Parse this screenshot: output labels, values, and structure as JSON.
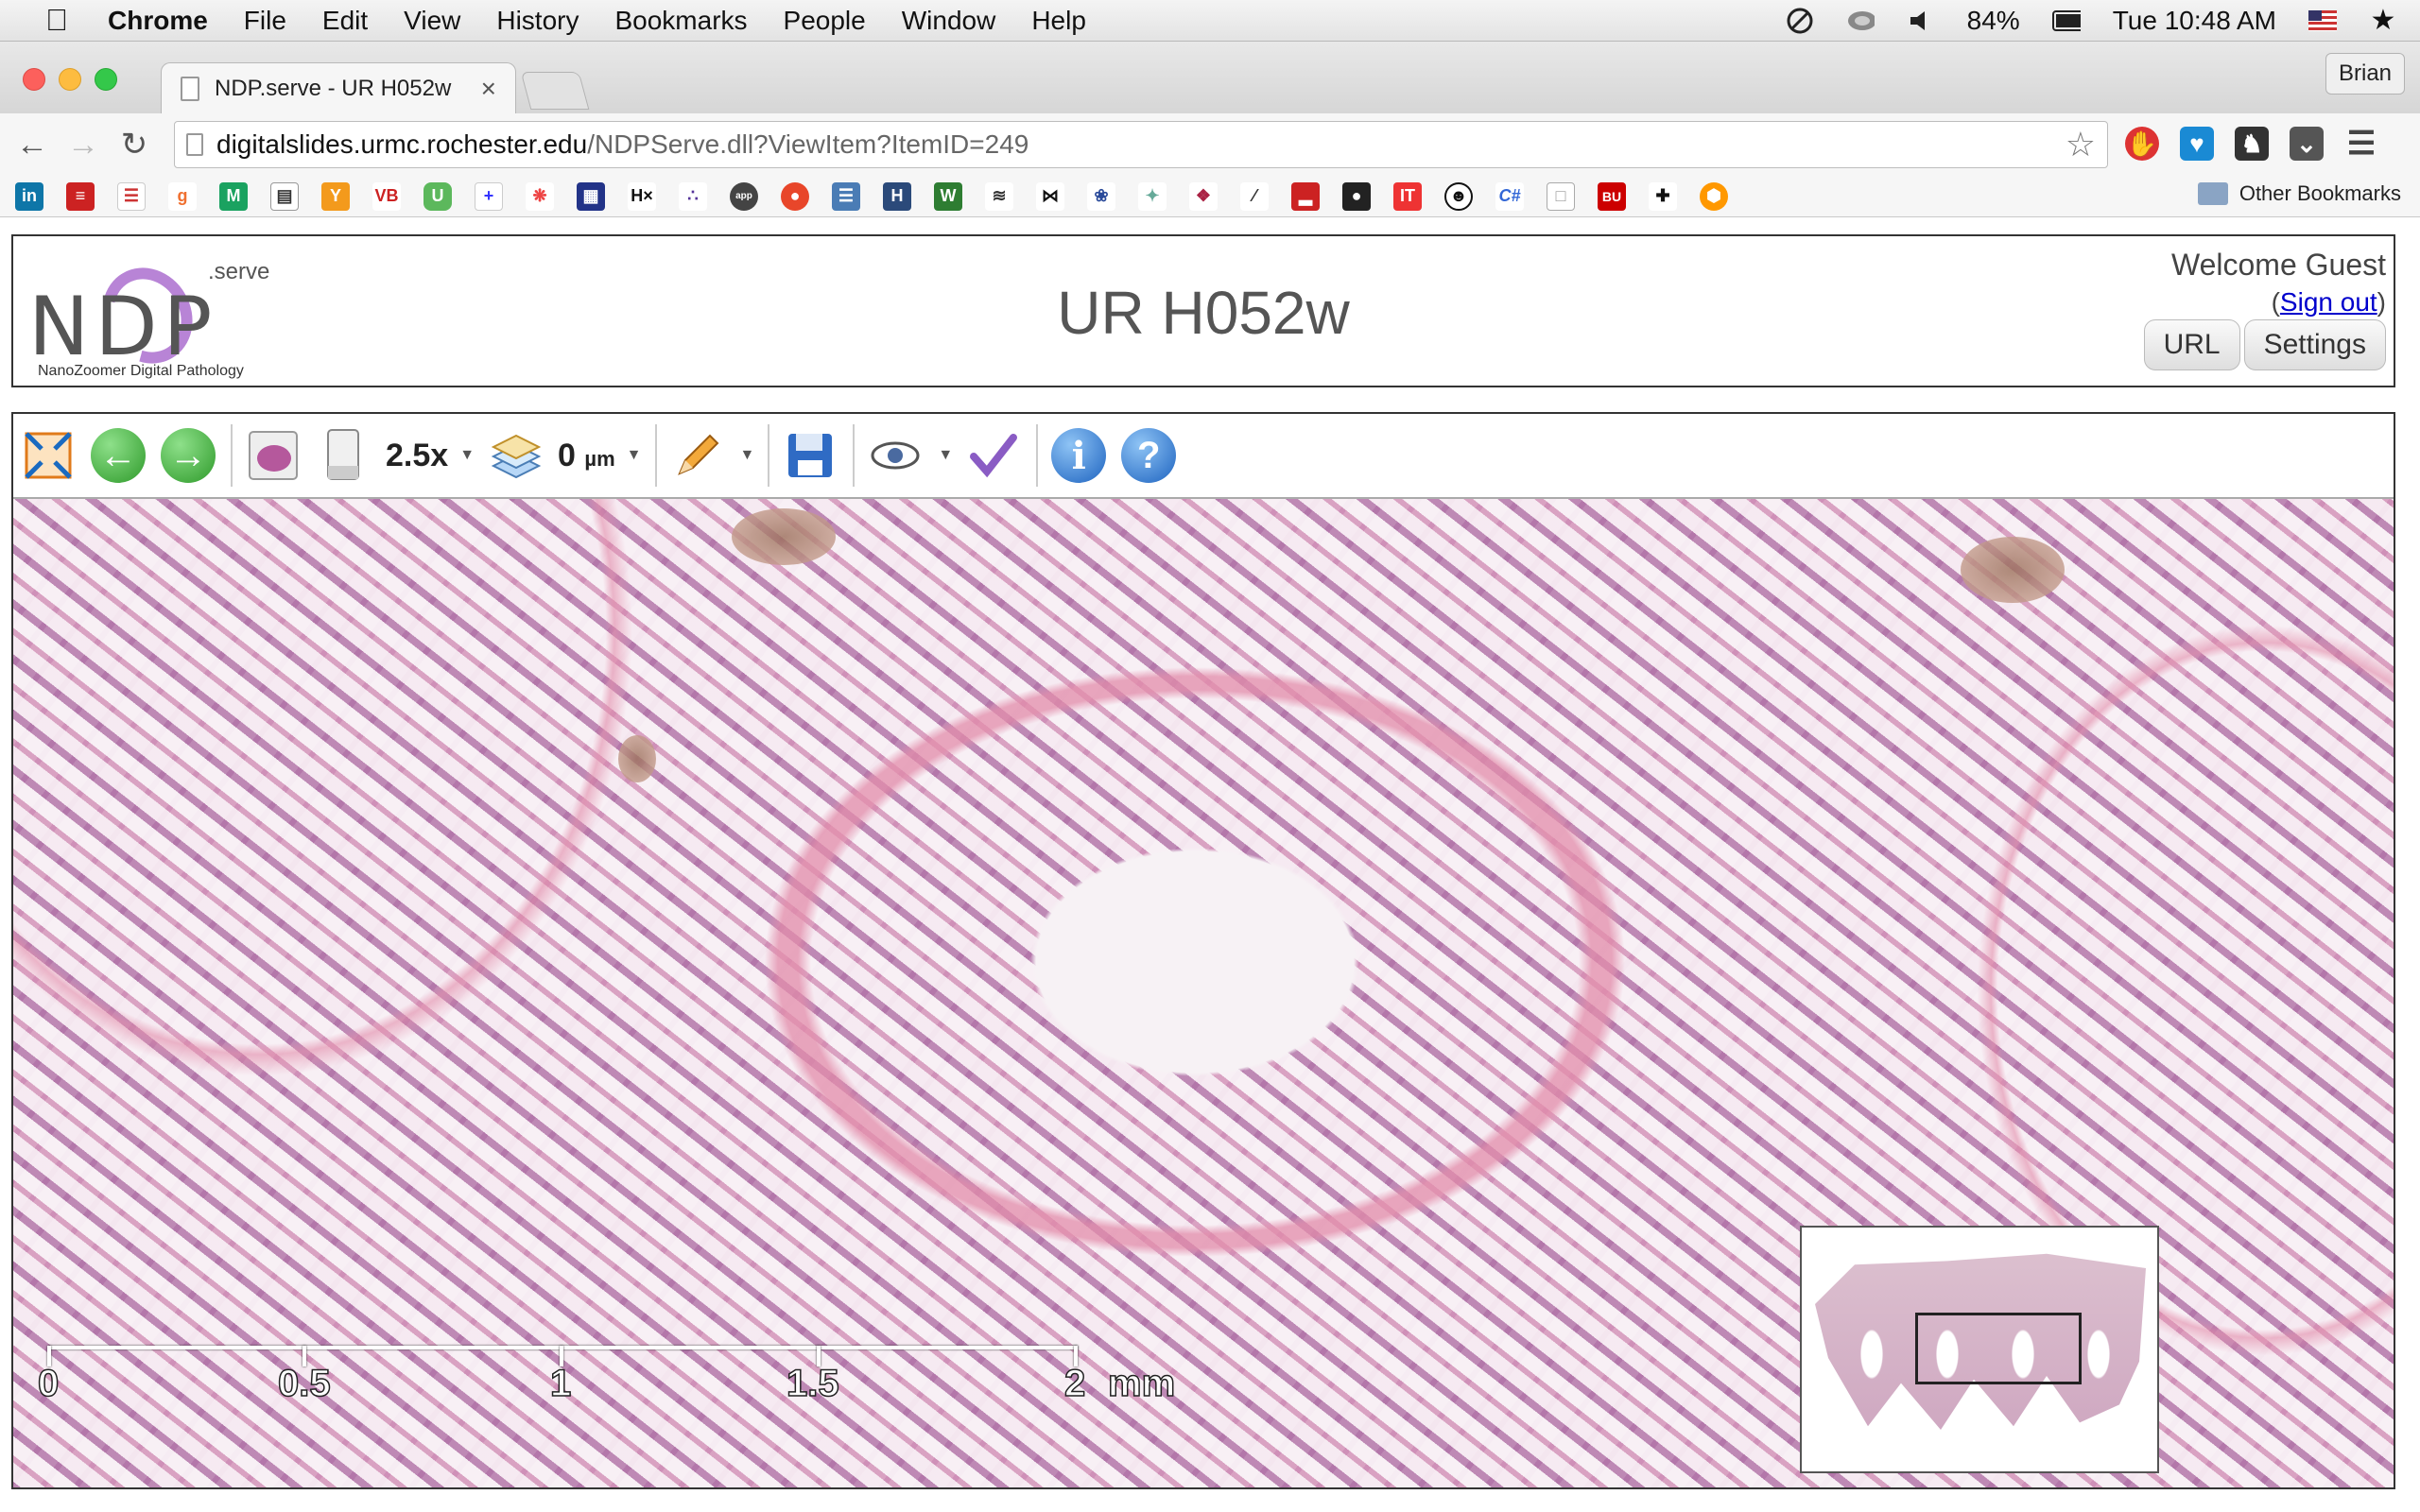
{
  "menubar": {
    "app": "Chrome",
    "items": [
      "File",
      "Edit",
      "View",
      "History",
      "Bookmarks",
      "People",
      "Window",
      "Help"
    ],
    "battery": "84%",
    "clock": "Tue 10:48 AM"
  },
  "browser": {
    "tab_title": "NDP.serve - UR H052w",
    "tab_close": "×",
    "profile": "Brian",
    "url_host": "digitalslides.urmc.rochester.edu",
    "url_path": "/NDPServe.dll?ViewItem?ItemID=249",
    "other_bookmarks": "Other Bookmarks"
  },
  "ndp": {
    "logo_serve": ".serve",
    "logo_letters": "NDP",
    "logo_tagline": "NanoZoomer Digital Pathology",
    "title": "UR H052w",
    "welcome": "Welcome Guest",
    "signout": "Sign out",
    "url_button": "URL",
    "settings_button": "Settings"
  },
  "viewer": {
    "zoom": "2.5x",
    "focus_value": "0",
    "focus_unit": "µm",
    "scale_labels": [
      "0",
      "0.5",
      "1",
      "1.5",
      "2"
    ],
    "scale_unit": "mm"
  },
  "colors": {
    "tissue_pink": "#e8c8da",
    "stain_purple": "#9b5596",
    "logo_purple": "#b884d6",
    "link_blue": "#0000cc"
  }
}
